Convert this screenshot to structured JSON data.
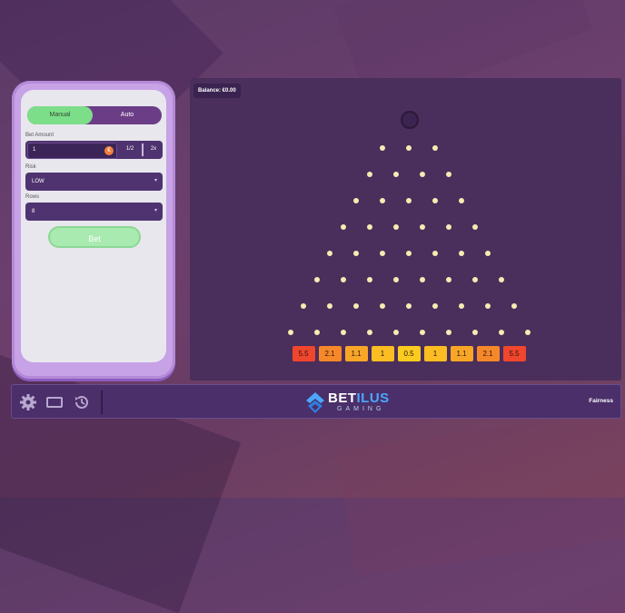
{
  "controls": {
    "tabs": [
      {
        "label": "Manual",
        "active": true
      },
      {
        "label": "Auto",
        "active": false
      }
    ],
    "bet_amount_label": "Bet Amount",
    "bet_amount_value": "1",
    "currency_symbol": "€",
    "half_label": "1/2",
    "double_label": "2x",
    "risk_label": "Risk",
    "risk_value": "LOW",
    "rows_label": "Rows",
    "rows_value": "8",
    "bet_button_label": "Bet"
  },
  "board": {
    "balance_text": "Balance: €0.00",
    "multipliers": [
      "5.5",
      "2.1",
      "1.1",
      "1",
      "0.5",
      "1",
      "1.1",
      "2.1",
      "5.5"
    ],
    "multiplier_colors": [
      "#f0462d",
      "#f7882a",
      "#f9a627",
      "#fbbd22",
      "#fccb1f",
      "#fbbd22",
      "#f9a627",
      "#f7882a",
      "#f0462d"
    ]
  },
  "footer": {
    "icons": [
      "gear-icon",
      "screen-icon",
      "history-icon"
    ],
    "logo_primary": "BET",
    "logo_accent": "ILUS",
    "logo_sub": "GAMING",
    "fairness_label": "Fairness"
  },
  "colors": {
    "accent_green": "#7dde8a",
    "panel_purple": "#4f3370",
    "peg": "#f5ecb2"
  }
}
